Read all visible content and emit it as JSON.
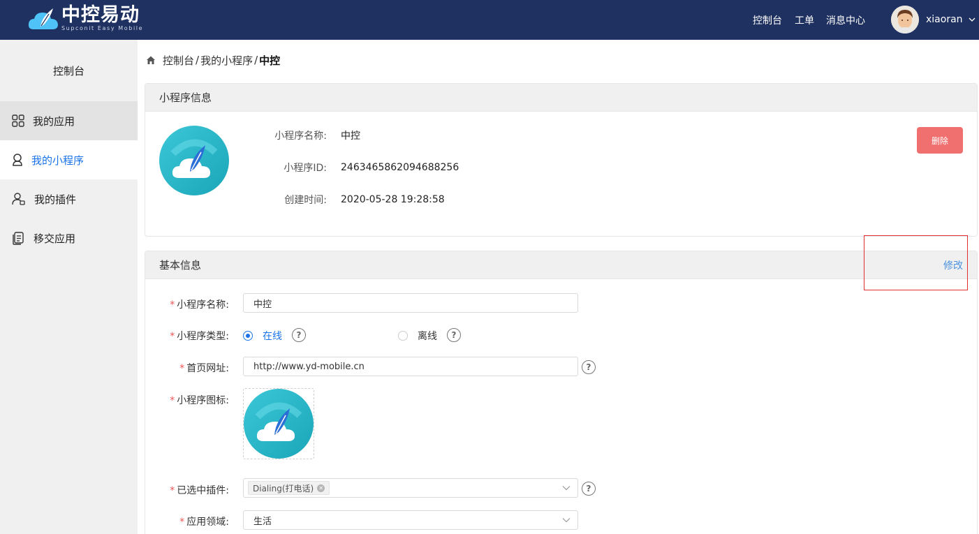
{
  "header": {
    "logo_cn": "中控易动",
    "logo_en": "Supconit Easy Mobile",
    "nav": [
      "控制台",
      "工单",
      "消息中心"
    ],
    "username": "xiaoran"
  },
  "sidebar": {
    "title": "控制台",
    "items": [
      {
        "label": "我的应用",
        "icon": "grid-icon"
      },
      {
        "label": "我的小程序",
        "icon": "miniprogram-icon"
      },
      {
        "label": "我的插件",
        "icon": "user-plugin-icon"
      },
      {
        "label": "移交应用",
        "icon": "transfer-doc-icon"
      }
    ],
    "active_index": 1
  },
  "breadcrumb": {
    "items": [
      "控制台",
      "我的小程序"
    ],
    "separator": "/",
    "current": "中控"
  },
  "mini_info": {
    "title": "小程序信息",
    "rows": [
      {
        "label": "小程序名称:",
        "value": "中控"
      },
      {
        "label": "小程序ID:",
        "value": "2463465862094688256"
      },
      {
        "label": "创建时间:",
        "value": "2020-05-28 19:28:58"
      }
    ],
    "delete_label": "删除",
    "delete_color": "#f07070"
  },
  "basic_info": {
    "title": "基本信息",
    "edit_label": "修改",
    "fields": {
      "name": {
        "label": "小程序名称:",
        "value": "中控"
      },
      "type": {
        "label": "小程序类型:",
        "options": [
          "在线",
          "离线"
        ],
        "selected": "在线"
      },
      "homepage": {
        "label": "首页网址:",
        "value": "http://www.yd-mobile.cn"
      },
      "icon": {
        "label": "小程序图标:"
      },
      "plugins": {
        "label": "已选中插件:",
        "tags": [
          "Dialing(打电话)"
        ]
      },
      "domain": {
        "label": "应用领域:",
        "value": "生活"
      }
    },
    "required_mark": "*",
    "help_mark": "?"
  },
  "colors": {
    "header_bg": "#1f3160",
    "accent": "#1a73e8",
    "danger": "#f07070",
    "link": "#4a90e2"
  }
}
